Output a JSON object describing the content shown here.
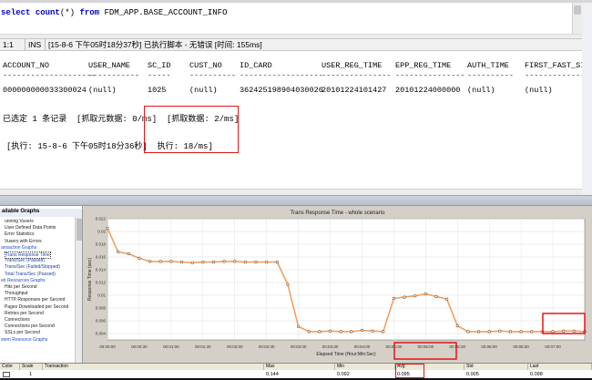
{
  "sql": {
    "kw_select": "select",
    "fn_count": "count",
    "args": "(*) ",
    "kw_from": "from",
    "table": " FDM_APP.BASE_ACCOUNT_INFO"
  },
  "status": {
    "position": "1:1",
    "mode": "INS",
    "message": "[15-8-6 下午05时18分37秒] 已执行脚本 - 无错误  [时间: 155ms]"
  },
  "results": {
    "columns": [
      "ACCOUNT_NO",
      "USER_NAME",
      "SC_ID",
      "CUST_NO",
      "ID_CARD",
      "USER_REG_TIME",
      "EPP_REG_TIME",
      "AUTH_TIME",
      "FIRST_FAST_SIGN_"
    ],
    "dashes": [
      "--------------------",
      "-----------",
      "-----",
      "----------",
      "------------------",
      "---------------",
      "---------------",
      "----------",
      "----------------"
    ],
    "row": [
      "000000000033300024",
      "(null)",
      "1025",
      "(null)",
      "36242519890403002​6",
      "20101224101427",
      "20101224000000",
      "(null)",
      "(null)"
    ],
    "selected_msg": "已选定 1 条记录  [抓取元数据: 0/ms]",
    "fetch_msg": "[抓取数据: 2/ms]",
    "exec_time_msg": "[执行: 15-8-6 下午05时18分36秒]",
    "exec_msg": "执行: 18/ms]"
  },
  "tree": {
    "title": "ailable Graphs",
    "items": [
      {
        "label": "unning Vusers",
        "kind": "lvl2"
      },
      {
        "label": "User Defined Data Points",
        "kind": "lvl2"
      },
      {
        "label": "Error Statistics",
        "kind": "lvl2"
      },
      {
        "label": "Vusers with Errors",
        "kind": "lvl2"
      },
      {
        "label": "ansaction Graphs",
        "kind": "cat"
      },
      {
        "label": "Trans Response Time",
        "kind": "selected"
      },
      {
        "label": "Trans/Sec (Passed)",
        "kind": "item"
      },
      {
        "label": "Trans/Sec (Failed/Stopped)",
        "kind": "item"
      },
      {
        "label": "Total Trans/Sec (Passed)",
        "kind": "item"
      },
      {
        "label": "eb Resources Graphs",
        "kind": "cat"
      },
      {
        "label": "Hits per Second",
        "kind": "lvl2"
      },
      {
        "label": "Throughput",
        "kind": "lvl2"
      },
      {
        "label": "HTTP Responses per Second",
        "kind": "lvl2"
      },
      {
        "label": "Pages Downloaded per Second",
        "kind": "lvl2"
      },
      {
        "label": "Retries per Second",
        "kind": "lvl2"
      },
      {
        "label": "Connections",
        "kind": "lvl2"
      },
      {
        "label": "Connections per Second",
        "kind": "lvl2"
      },
      {
        "label": "SSLs per Second",
        "kind": "lvl2"
      },
      {
        "label": "stem Resource Graphs",
        "kind": "cat"
      }
    ]
  },
  "graph": {
    "title": "Trans Response Time - whole scenario",
    "line_color": "#f0a060",
    "marker_color": "#7a4a2a",
    "highlight_color": "#e0161b"
  },
  "chart_data": {
    "type": "line",
    "title": "Trans Response Time - whole scenario",
    "xlabel": "Elapsed Time (Hour:Min:Sec)",
    "ylabel": "Response Time (sec)",
    "x_ticks": [
      "00:00:00",
      "00:00:30",
      "00:01:00",
      "00:01:30",
      "00:02:00",
      "00:02:30",
      "00:03:00",
      "00:03:30",
      "00:04:00",
      "00:04:30",
      "00:05:00",
      "00:05:30",
      "00:06:00",
      "00:06:30",
      "00:07:00"
    ],
    "y_ticks": [
      "0.022",
      "0.02",
      "0.018",
      "0.016",
      "0.014",
      "0.012",
      "0.01",
      "0.008",
      "0.006",
      "0.004"
    ],
    "ylim": [
      0.003,
      0.022
    ],
    "xlim_sec": [
      0,
      450
    ],
    "x_sec": [
      0,
      10,
      20,
      30,
      40,
      50,
      60,
      70,
      80,
      90,
      100,
      110,
      120,
      130,
      140,
      150,
      160,
      170,
      180,
      190,
      200,
      210,
      220,
      230,
      240,
      250,
      260,
      270,
      280,
      290,
      300,
      310,
      320,
      330,
      340,
      350,
      360,
      370,
      380,
      390,
      400,
      410,
      420,
      430,
      440,
      450
    ],
    "y": [
      0.0205,
      0.0168,
      0.0165,
      0.0158,
      0.0153,
      0.0153,
      0.0153,
      0.0152,
      0.0151,
      0.0152,
      0.0152,
      0.0153,
      0.0153,
      0.0152,
      0.0152,
      0.0152,
      0.0152,
      0.0117,
      0.0051,
      0.0043,
      0.0043,
      0.0044,
      0.0043,
      0.0043,
      0.0045,
      0.0044,
      0.0043,
      0.0095,
      0.0097,
      0.0099,
      0.0102,
      0.0098,
      0.0094,
      0.0052,
      0.0043,
      0.0043,
      0.0043,
      0.0044,
      0.0043,
      0.0043,
      0.0043,
      0.0043,
      0.0043,
      0.0044,
      0.0044,
      0.0043
    ],
    "grid": true,
    "legend": "none"
  },
  "legend_table": {
    "headers": [
      "Color",
      "Scale",
      "Transaction",
      "Max",
      "Min",
      "Avg",
      "Std",
      "Last"
    ],
    "values": [
      "",
      "1",
      "",
      "0.144",
      "0.092",
      "0.095",
      "0.005",
      "0.098"
    ]
  }
}
